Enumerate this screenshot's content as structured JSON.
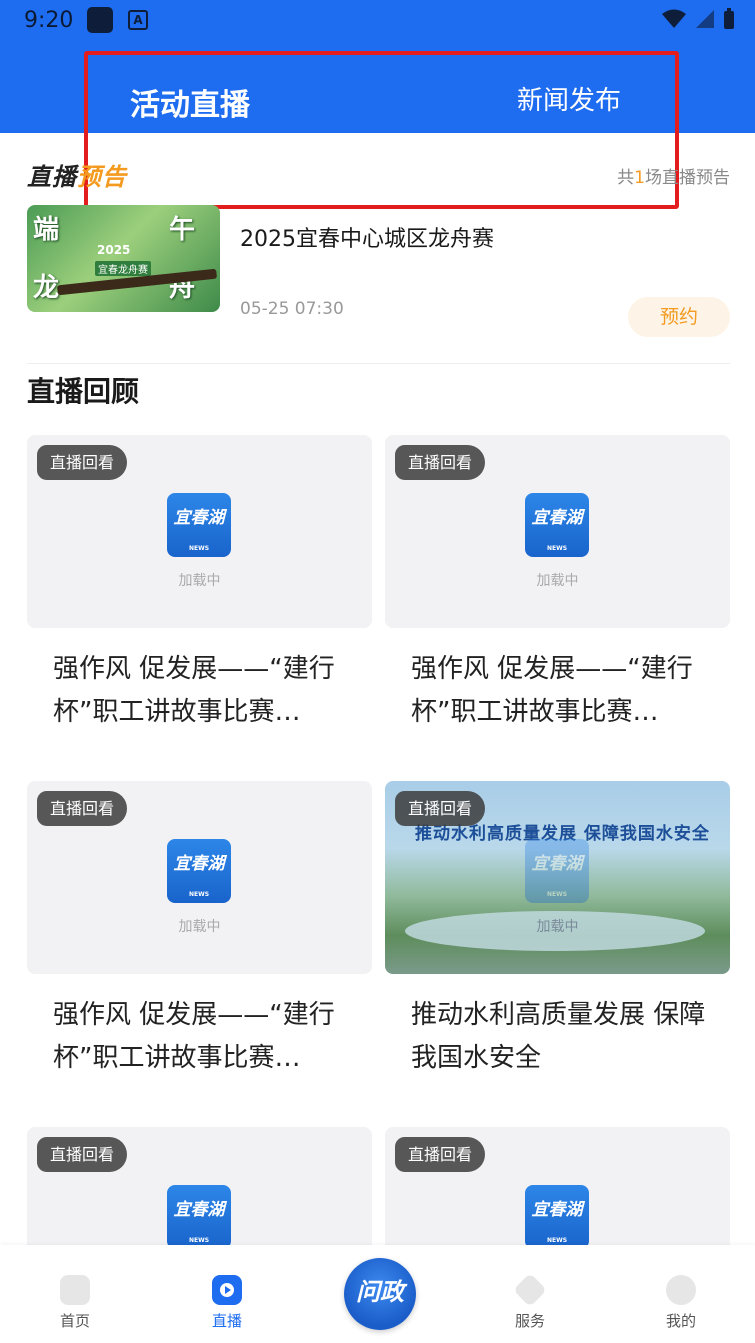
{
  "status_bar": {
    "time": "9:20",
    "app_icon_letter": "A"
  },
  "header": {
    "tab_live": "活动直播",
    "tab_news": "新闻发布"
  },
  "preview": {
    "logo_part1": "直播",
    "logo_part2": "预告",
    "count_prefix": "共",
    "count_num": "1",
    "count_suffix": "场直播预告",
    "event": {
      "title": "2025宜春中心城区龙舟赛",
      "time": "05-25 07:30",
      "reserve_label": "预约",
      "thumb_chars": [
        "端",
        "午",
        "龙",
        "舟"
      ],
      "thumb_year": "2025",
      "thumb_sub": "宜春龙舟赛"
    }
  },
  "replay": {
    "section_title": "直播回顾",
    "badge": "直播回看",
    "loading": "加载中",
    "logo_text": "宜春湖",
    "logo_news": "NEWS",
    "cards": [
      {
        "title": "强作风 促发展——“建行杯”职工讲故事比赛…"
      },
      {
        "title": "强作风 促发展——“建行杯”职工讲故事比赛…"
      },
      {
        "title": "强作风 促发展——“建行杯”职工讲故事比赛…"
      },
      {
        "title": "推动水利高质量发展 保障我国水安全",
        "photo_headline": "推动水利高质量发展  保障我国水安全"
      }
    ]
  },
  "bottom_nav": {
    "items": [
      {
        "label": "首页"
      },
      {
        "label": "直播"
      },
      {
        "label": "服务"
      },
      {
        "label": "我的"
      }
    ],
    "center_label": "问政"
  },
  "colors": {
    "primary": "#1e6cf0",
    "accent": "#f39a1f",
    "highlight": "#e31d1d"
  }
}
